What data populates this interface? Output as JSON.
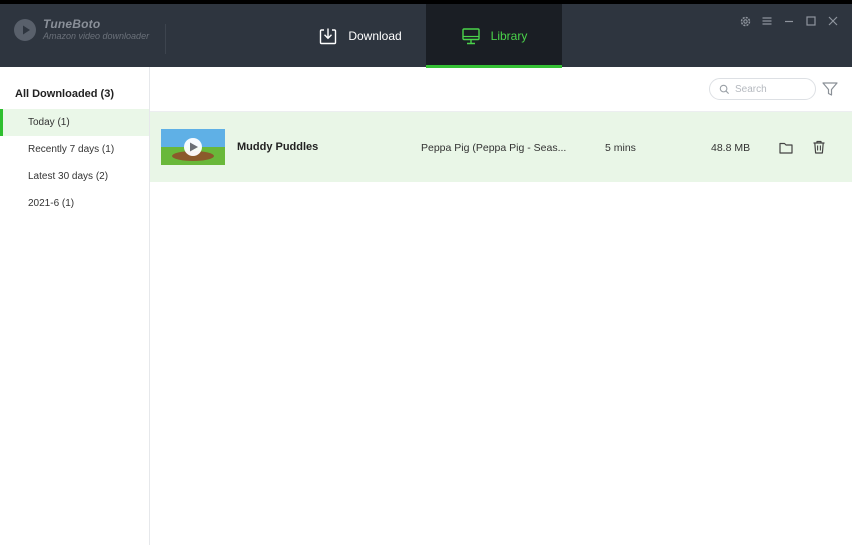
{
  "app": {
    "name": "TuneBoto",
    "subtitle": "Amazon video downloader"
  },
  "nav": {
    "download_label": "Download",
    "library_label": "Library",
    "active": "library"
  },
  "window_controls": [
    "gear-icon",
    "menu-icon",
    "minimize-icon",
    "maximize-icon",
    "close-icon"
  ],
  "sidebar": {
    "header": "All Downloaded (3)",
    "items": [
      {
        "label": "Today (1)",
        "active": true
      },
      {
        "label": "Recently 7 days (1)",
        "active": false
      },
      {
        "label": "Latest 30 days (2)",
        "active": false
      },
      {
        "label": "2021-6 (1)",
        "active": false
      }
    ]
  },
  "search": {
    "placeholder": "Search",
    "value": ""
  },
  "library": {
    "rows": [
      {
        "title": "Muddy Puddles",
        "series": "Peppa Pig (Peppa Pig - Seas...",
        "duration": "5 mins",
        "size": "48.8 MB"
      }
    ]
  },
  "colors": {
    "titlebar": "#2e353f",
    "active_tab": "#1a1e24",
    "accent_green": "#35c135",
    "row_highlight": "#e9f6e7"
  }
}
